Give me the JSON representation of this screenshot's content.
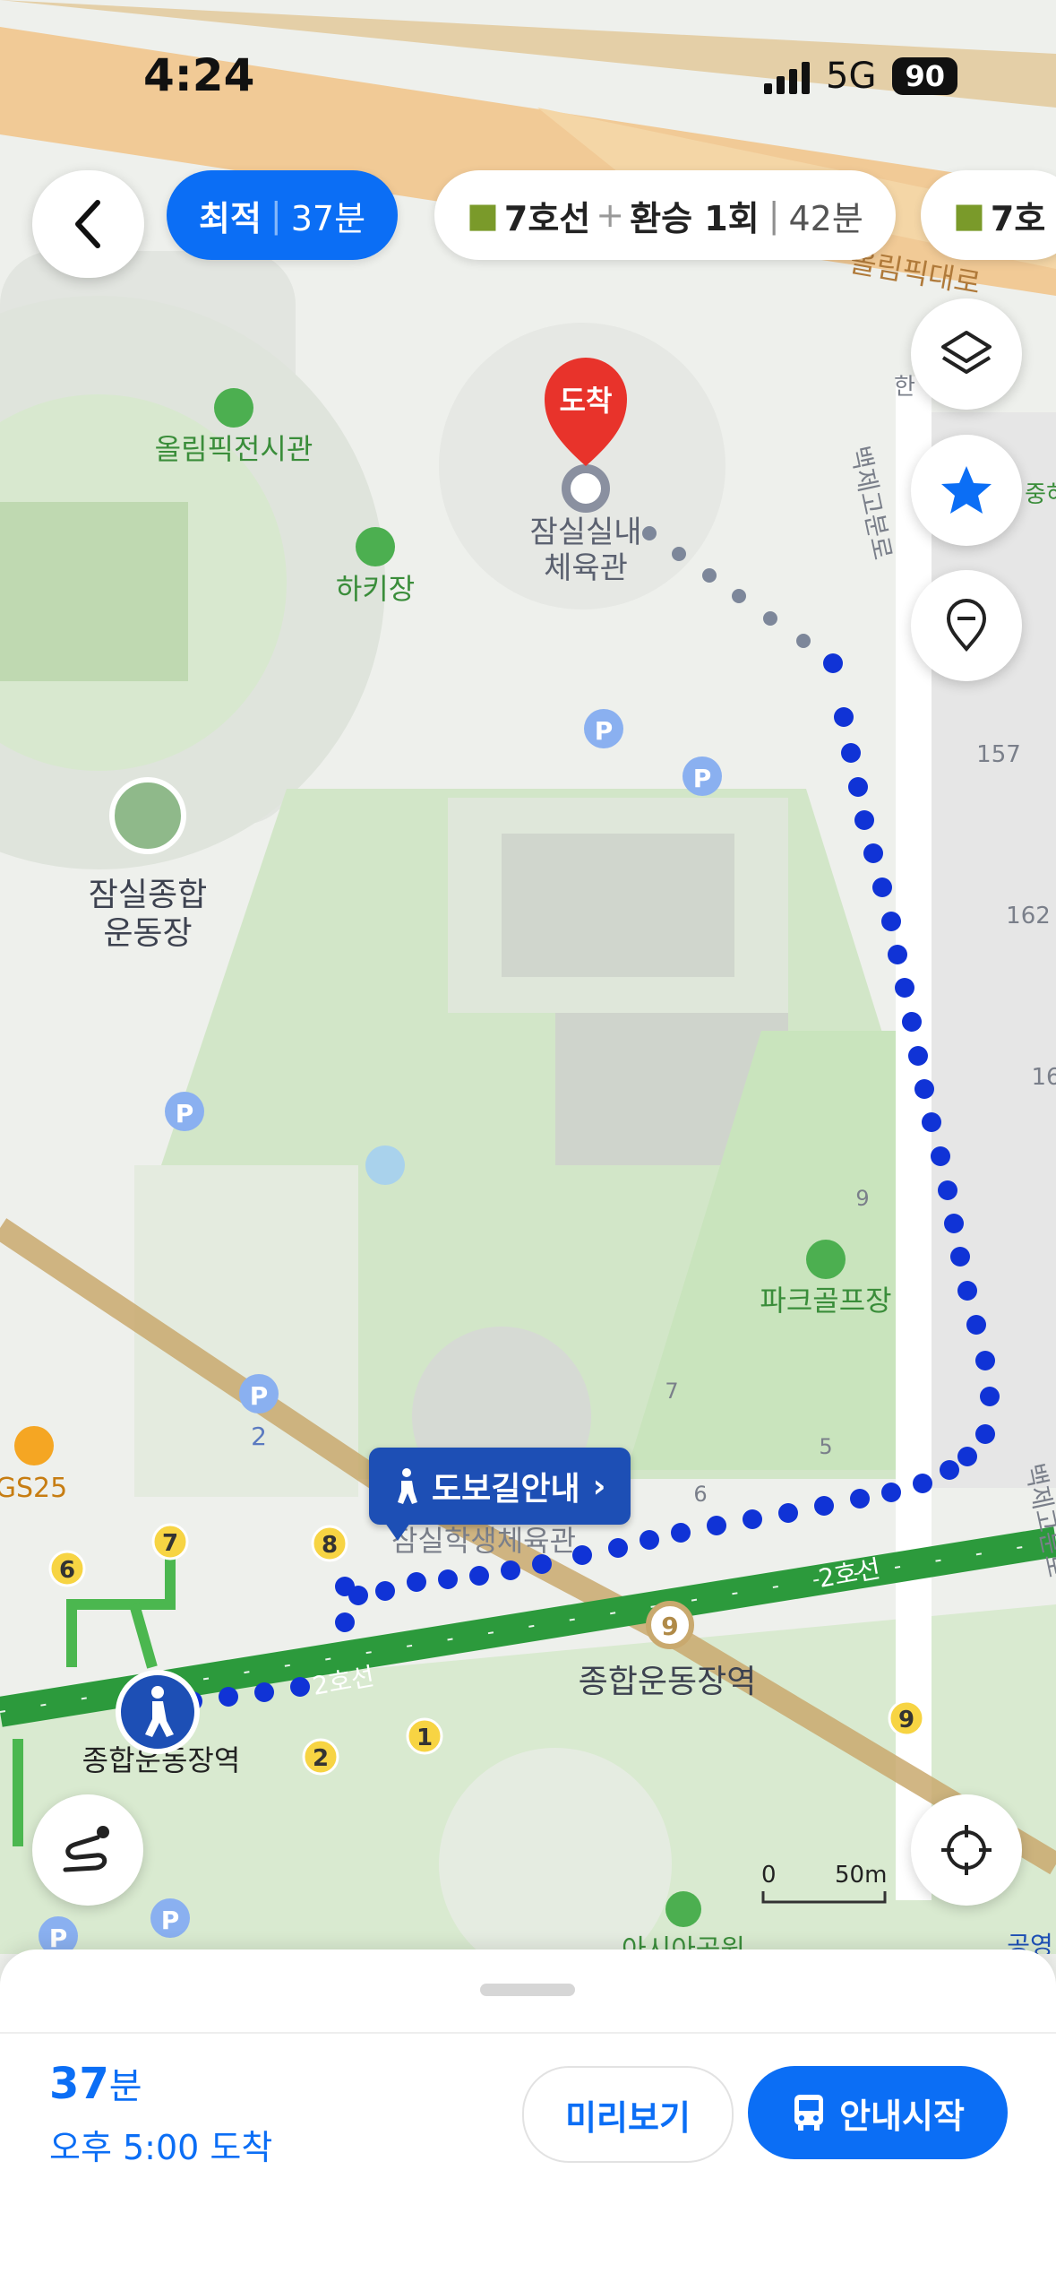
{
  "status_bar": {
    "time": "4:24",
    "network": "5G",
    "battery": "90"
  },
  "route_options": {
    "best": {
      "label": "최적",
      "duration": "37분"
    },
    "alt1": {
      "line": "7호선",
      "plus": "+",
      "transfer": "환승 1회",
      "duration": "42분"
    },
    "alt2": {
      "line": "7호"
    }
  },
  "map_labels": {
    "destination_pin": "도착",
    "destination_name_line1": "잠실실내",
    "destination_name_line2": "체육관",
    "olympic_hall": "올림픽전시관",
    "hockey": "하키장",
    "stadium_line1": "잠실종합",
    "stadium_line2": "운동장",
    "park_golf": "파크골프장",
    "student_gym": "잠실학생체육관",
    "station_main": "종합운동장역",
    "station_left": "종합운동장역",
    "line2_a": "2호선",
    "line2_b": "2호선",
    "road_top": "올림픽대로",
    "road_right": "백제고분로",
    "road_right2": "백제고분로",
    "gs25": "GS25",
    "asian_park": "아시아공원",
    "building_157": "157",
    "building_162": "162",
    "building_16": "16",
    "bldg_num_9": "9",
    "bldg_num_7": "7",
    "bldg_num_5": "5",
    "bldg_num_6": "6",
    "parking": "P",
    "parking_2": "2",
    "exit_8": "8",
    "exit_7": "7",
    "exit_6": "6",
    "exit_2": "2",
    "exit_1": "1",
    "exit_9": "9",
    "line9_badge": "9",
    "right_cut_label": "중혀",
    "right_cut_label2": "한",
    "bottom_right_cut": "공영",
    "scale_zero": "0",
    "scale_dist": "50m"
  },
  "walk_guide": {
    "label": "도보길안내",
    "chevron": "›"
  },
  "bottom_sheet": {
    "duration_num": "37",
    "duration_unit": "분",
    "arrival": "오후 5:00 도착",
    "preview_button": "미리보기",
    "start_button": "안내시작"
  },
  "colors": {
    "accent": "#0b6ef5",
    "route_dots": "#1033d6",
    "line2_green": "#2c9a3c",
    "line9_gold": "#c9a96e",
    "pin_red": "#e8332b",
    "park_green": "#cfe6c6"
  },
  "icons": {
    "back": "chevron-left-icon",
    "layers": "layers-icon",
    "favorite": "star-icon",
    "location_pin": "location-pin-icon",
    "route_settings": "route-icon",
    "current_location": "crosshair-icon",
    "walker": "pedestrian-icon",
    "bus": "bus-icon"
  }
}
